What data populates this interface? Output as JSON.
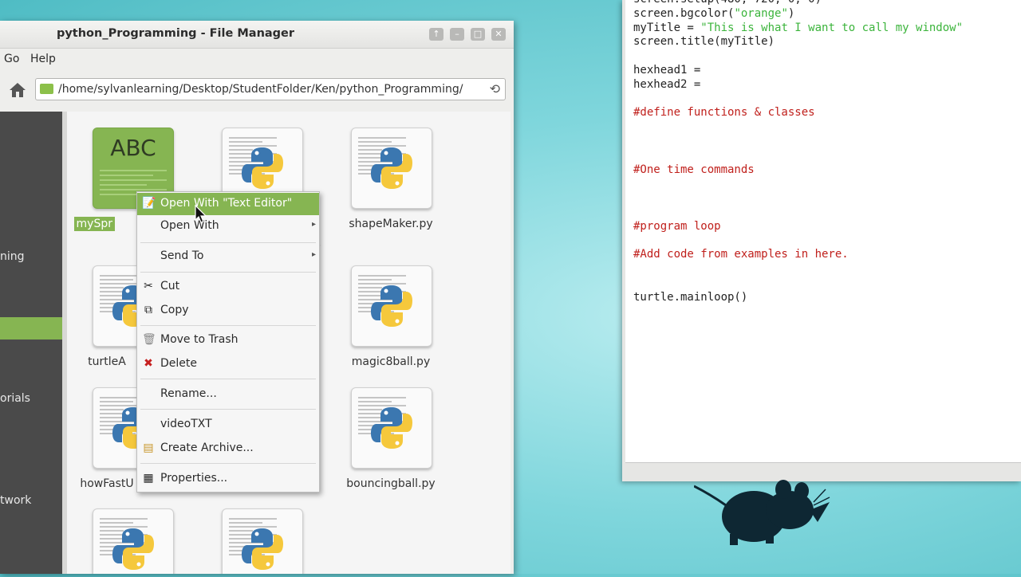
{
  "file_manager": {
    "title": "python_Programming - File Manager",
    "window_buttons": [
      "↑",
      "–",
      "□",
      "✕"
    ],
    "menu": [
      "Go",
      "Help"
    ],
    "path": "/home/sylvanlearning/Desktop/StudentFolder/Ken/python_Programming/",
    "sidebar_items": [
      "ning",
      "orials",
      "twork"
    ],
    "files": [
      {
        "name": "mySpr",
        "kind": "text"
      },
      {
        "name": "",
        "kind": "python"
      },
      {
        "name": "shapeMaker.py",
        "kind": "python"
      },
      {
        "name": "turtleA",
        "kind": "python"
      },
      {
        "name": "magic8ball.py",
        "kind": "python"
      },
      {
        "name": "howFastU",
        "kind": "python"
      },
      {
        "name": "bouncingball.py",
        "kind": "python"
      },
      {
        "name": "",
        "kind": "python"
      },
      {
        "name": "",
        "kind": "python"
      }
    ],
    "partial_label_fragment": "p"
  },
  "context_menu": {
    "items": [
      {
        "label": "Open With \"Text Editor\"",
        "icon": "text-editor-icon"
      },
      {
        "label": "Open With",
        "icon": ""
      },
      {
        "label": "Send To",
        "icon": ""
      },
      {
        "label": "Cut",
        "icon": "scissors-icon"
      },
      {
        "label": "Copy",
        "icon": "copy-icon"
      },
      {
        "label": "Move to Trash",
        "icon": "trash-icon"
      },
      {
        "label": "Delete",
        "icon": "delete-icon"
      },
      {
        "label": "Rename...",
        "icon": ""
      },
      {
        "label": "videoTXT",
        "icon": ""
      },
      {
        "label": "Create Archive...",
        "icon": "archive-icon"
      },
      {
        "label": "Properties...",
        "icon": "properties-icon"
      }
    ]
  },
  "editor": {
    "lines": [
      "screen.setup(480, 720, 0, 0)",
      "screen.bgcolor(\"orange\")",
      "myTitle = \"This is what I want to call my window\"",
      "screen.title(myTitle)",
      "",
      "hexhead1 =",
      "hexhead2 =",
      "",
      "#define functions & classes",
      "",
      "",
      "",
      "#One time commands",
      "",
      "",
      "",
      "#program loop",
      "",
      "#Add code from examples in here.",
      "",
      "",
      "turtle.mainloop()"
    ]
  },
  "colors": {
    "accent_green": "#86b552",
    "desktop_teal": "#7fd6dc",
    "comment_red": "#c0201c",
    "string_green": "#3bb43b"
  }
}
